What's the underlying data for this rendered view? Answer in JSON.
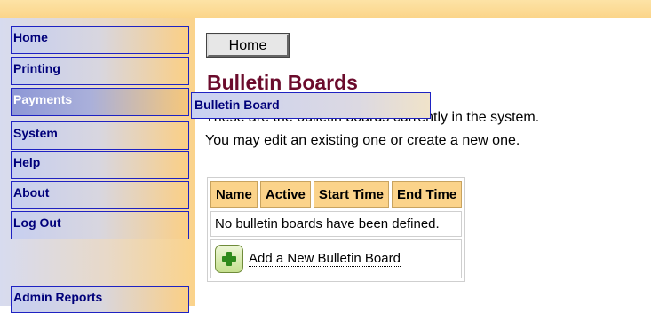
{
  "nav": {
    "items": [
      {
        "label": "Home",
        "active": false
      },
      {
        "label": "Printing",
        "active": false
      },
      {
        "label": "Payments",
        "active": true
      },
      {
        "label": "System",
        "active": false
      },
      {
        "label": "Help",
        "active": false
      },
      {
        "label": "About",
        "active": false
      },
      {
        "label": "Log Out",
        "active": false
      }
    ],
    "admin_reports": "Admin Reports",
    "flyout": "Bulletin Board"
  },
  "main": {
    "home_button": "Home",
    "title": "Bulletin Boards",
    "intro_line1": "These are the bulletin boards currently in the system.",
    "intro_line2": "You may edit an existing one or create a new one.",
    "table": {
      "headers": [
        "Name",
        "Active",
        "Start Time",
        "End Time"
      ],
      "empty_message": "No bulletin boards have been defined.",
      "add_label": "Add a New Bulletin Board"
    }
  },
  "colors": {
    "accent": "#fbd38a",
    "title": "#6b0b2c",
    "nav_text": "#00007a",
    "nav_border": "#1e22c2",
    "add_icon": "#2f8a1c"
  },
  "icons": {
    "add": "plus-icon"
  }
}
